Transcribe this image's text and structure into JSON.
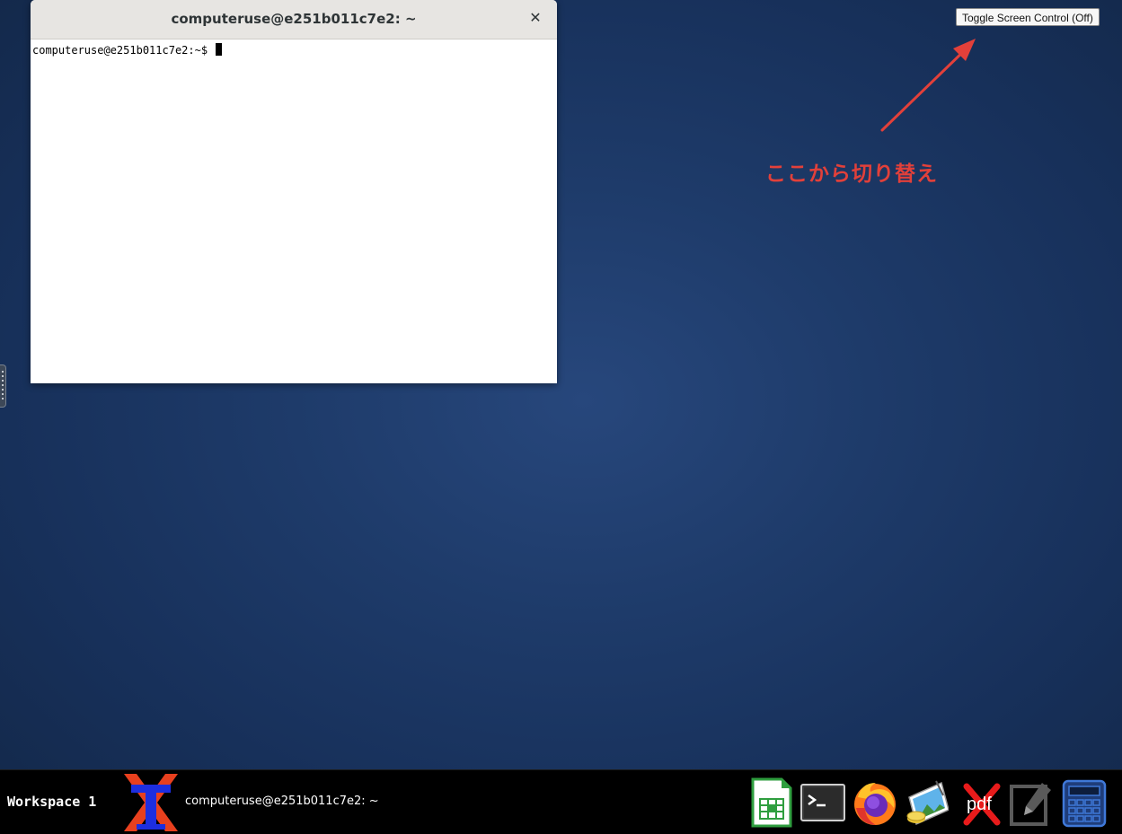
{
  "toggle_button": {
    "label": "Toggle Screen Control (Off)"
  },
  "annotation": {
    "text": "ここから切り替え",
    "color": "#e2403a"
  },
  "terminal": {
    "title": "computeruse@e251b011c7e2: ~",
    "close_glyph": "✕",
    "prompt": "computeruse@e251b011c7e2:~$ "
  },
  "taskbar": {
    "workspace_label": "Workspace 1",
    "active_task_title": "computeruse@e251b011c7e2: ~",
    "launchers": [
      {
        "icon": "spreadsheet-icon"
      },
      {
        "icon": "terminal-icon"
      },
      {
        "icon": "firefox-icon"
      },
      {
        "icon": "image-viewer-icon"
      },
      {
        "icon": "pdf-icon",
        "label": "pdf"
      },
      {
        "icon": "text-editor-icon"
      },
      {
        "icon": "calculator-icon"
      }
    ]
  }
}
